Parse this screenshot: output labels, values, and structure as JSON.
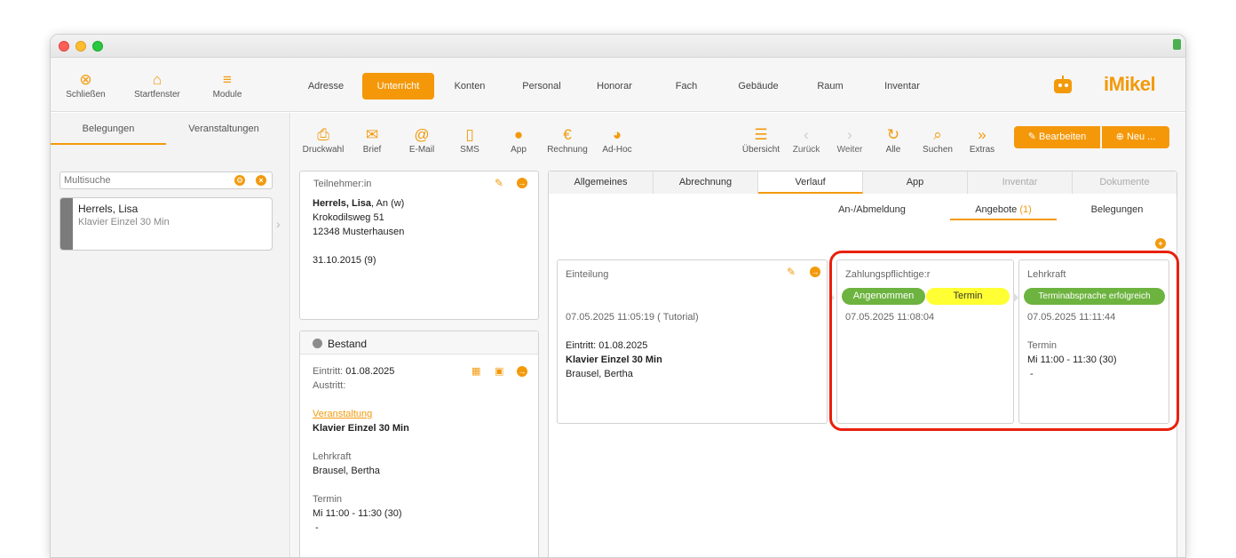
{
  "toolbar": {
    "close_label": "Schließen",
    "start_label": "Startfenster",
    "modules_label": "Module"
  },
  "nav_tabs": [
    "Adresse",
    "Unterricht",
    "Konten",
    "Personal",
    "Honorar",
    "Fach",
    "Gebäude",
    "Raum",
    "Inventar"
  ],
  "logo_text": "iMikel",
  "sidebar": {
    "tabs": [
      "Belegungen",
      "Veranstaltungen"
    ],
    "search_placeholder": "Multisuche",
    "list": [
      {
        "name": "Herrels, Lisa",
        "detail": "Klavier Einzel 30 Min"
      }
    ]
  },
  "actions": {
    "left": [
      "Druckwahl",
      "Brief",
      "E-Mail",
      "SMS",
      "App",
      "Rechnung",
      "Ad-Hoc"
    ],
    "right": [
      "Übersicht",
      "Zurück",
      "Weiter",
      "Alle",
      "Suchen",
      "Extras"
    ],
    "edit_button": "Bearbeiten",
    "new_button": "Neu ..."
  },
  "participant": {
    "title": "Teilnehmer:in",
    "name": "Herrels, Lisa",
    "name_suffix": ", An (w)",
    "street": "Krokodilsweg 51",
    "city": "12348 Musterhausen",
    "birth": "31.10.2015 (9)"
  },
  "bestand": {
    "title": "Bestand",
    "entry_label": "Eintritt:",
    "entry_value": "01.08.2025",
    "exit_label": "Austritt:",
    "event_label": "Veranstaltung",
    "event_value": "Klavier Einzel 30 Min",
    "teacher_label": "Lehrkraft",
    "teacher_value": "Brausel, Bertha",
    "date_label": "Termin",
    "date_value": "Mi 11:00 - 11:30 (30)",
    "date_extra": "-"
  },
  "detail_tabs": [
    "Allgemeines",
    "Abrechnung",
    "Verlauf",
    "App",
    "Inventar",
    "Dokumente"
  ],
  "verlauf_subtabs": {
    "anmeldung": "An-/Abmeldung",
    "angebote": "Angebote",
    "angebote_count": "(1)",
    "belegungen": "Belegungen"
  },
  "einteilung": {
    "title": "Einteilung",
    "timestamp": "07.05.2025 11:05:19 ( Tutorial)",
    "entry": "Eintritt: 01.08.2025",
    "course": "Klavier Einzel 30 Min",
    "teacher": "Brausel, Bertha"
  },
  "payer": {
    "title": "Zahlungspflichtige:r",
    "status_accepted": "Angenommen",
    "status_date": "Termin",
    "timestamp": "07.05.2025 11:08:04"
  },
  "teacher_card": {
    "title": "Lehrkraft",
    "status": "Terminabsprache erfolgreich",
    "timestamp": "07.05.2025 11:11:44",
    "date_label": "Termin",
    "date_value": "Mi 11:00 - 11:30 (30)",
    "date_extra": "-"
  },
  "colors": {
    "accent": "#f4980a",
    "green": "#6db33f",
    "yellow": "#ffff33",
    "highlight": "#e8200c"
  }
}
